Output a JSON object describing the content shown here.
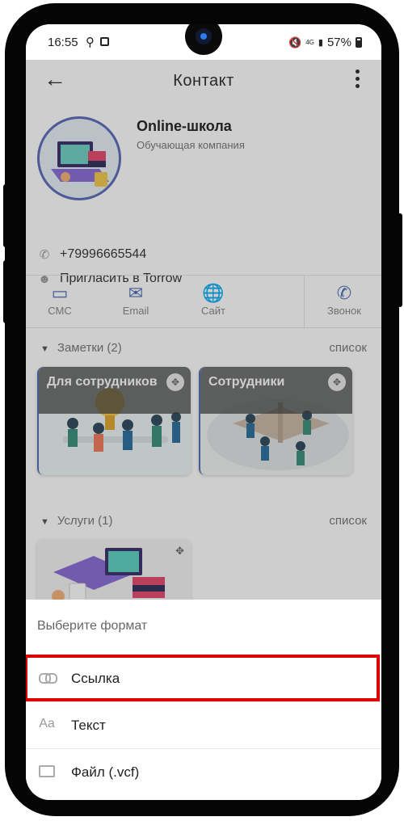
{
  "status_bar": {
    "time": "16:55",
    "network": "4G",
    "battery": "57%"
  },
  "header": {
    "title": "Контакт"
  },
  "contact": {
    "name": "Online-школа",
    "subtitle": "Обучающая компания",
    "phone": "+79996665544",
    "invite": "Пригласить в Torrow"
  },
  "actions": [
    {
      "label": "СМС",
      "icon": "chat-icon"
    },
    {
      "label": "Email",
      "icon": "mail-icon"
    },
    {
      "label": "Сайт",
      "icon": "globe-icon"
    },
    {
      "label": "Звонок",
      "icon": "phone-icon"
    }
  ],
  "notes": {
    "title": "Заметки (2)",
    "view": "список",
    "cards": [
      {
        "label": "Для сотрудников"
      },
      {
        "label": "Сотрудники"
      }
    ]
  },
  "services": {
    "title": "Услуги (1)",
    "view": "список"
  },
  "sheet": {
    "title": "Выберите формат",
    "items": [
      {
        "label": "Ссылка",
        "icon": "link-icon"
      },
      {
        "label": "Текст",
        "icon": "text-icon",
        "icon_text": "Aa"
      },
      {
        "label": "Файл (.vcf)",
        "icon": "folder-icon"
      }
    ]
  },
  "colors": {
    "accent": "#4d6fb5",
    "highlight": "#e00000"
  }
}
